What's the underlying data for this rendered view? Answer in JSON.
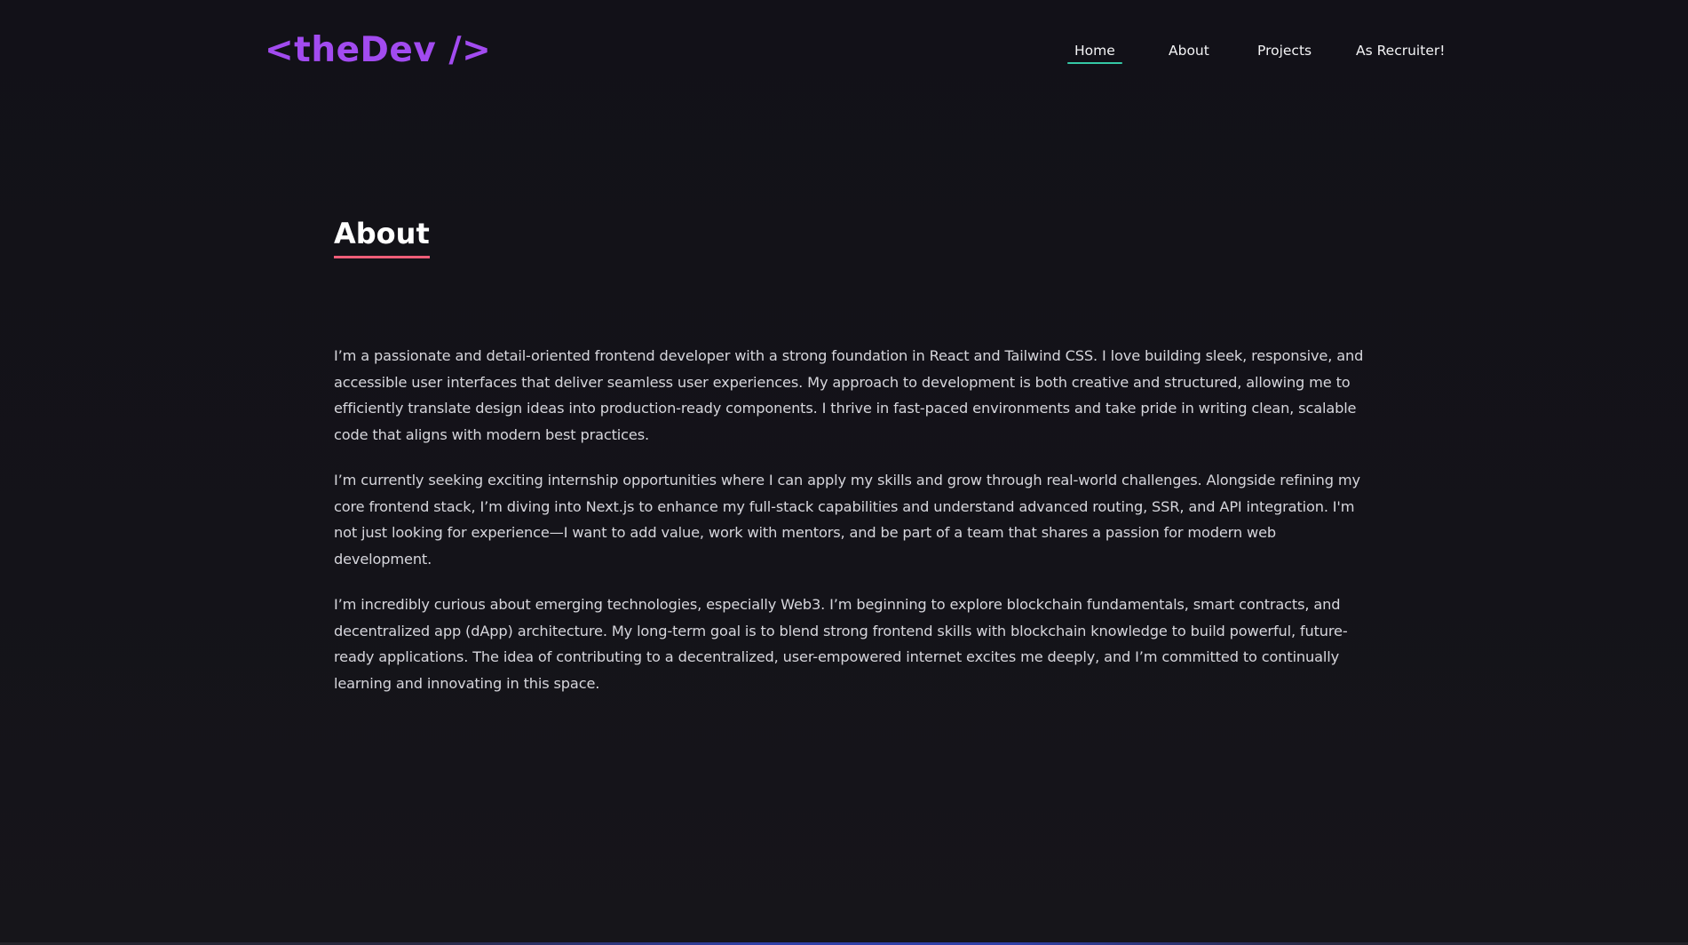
{
  "brand": {
    "logo_text": "<theDev />",
    "accent_color": "#a24bf0"
  },
  "nav": {
    "items": [
      {
        "label": "Home",
        "active": true
      },
      {
        "label": "About",
        "active": false
      },
      {
        "label": "Projects",
        "active": false
      },
      {
        "label": "As Recruiter!",
        "active": false
      }
    ],
    "active_underline_color": "#35c8a6"
  },
  "about": {
    "heading": "About",
    "heading_underline_color": "#ef5d78",
    "paragraphs": [
      "I’m a passionate and detail-oriented frontend developer with a strong foundation in React and Tailwind CSS. I love building sleek, responsive, and accessible user interfaces that deliver seamless user experiences. My approach to development is both creative and structured, allowing me to efficiently translate design ideas into production-ready components. I thrive in fast-paced environments and take pride in writing clean, scalable code that aligns with modern best practices.",
      "I’m currently seeking exciting internship opportunities where I can apply my skills and grow through real-world challenges. Alongside refining my core frontend stack, I’m diving into Next.js to enhance my full-stack capabilities and understand advanced routing, SSR, and API integration. I'm not just looking for experience—I want to add value, work with mentors, and be part of a team that shares a passion for modern web development.",
      "I’m incredibly curious about emerging technologies, especially Web3. I’m beginning to explore blockchain fundamentals, smart contracts, and decentralized app (dApp) architecture. My long-term goal is to blend strong frontend skills with blockchain knowledge to build powerful, future-ready applications. The idea of contributing to a decentralized, user-empowered internet excites me deeply, and I’m committed to continually learning and innovating in this space."
    ]
  },
  "colors": {
    "background": "#131218",
    "text": "#d6d6dc"
  }
}
